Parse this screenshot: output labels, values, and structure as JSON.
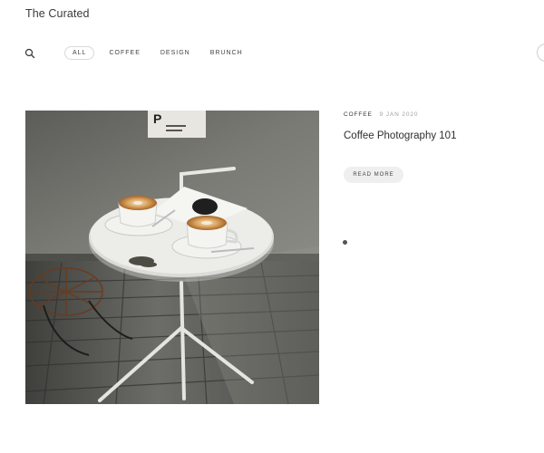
{
  "site": {
    "title": "The Curated"
  },
  "nav": {
    "search_icon": "search-icon",
    "items": [
      {
        "label": "ALL",
        "active": true
      },
      {
        "label": "COFFEE",
        "active": false
      },
      {
        "label": "DESIGN",
        "active": false
      },
      {
        "label": "BRUNCH",
        "active": false
      }
    ]
  },
  "post": {
    "image_description": "coffee-table-photo",
    "sign_letter": "P",
    "category": "COFFEE",
    "date": "9 JAN 2020",
    "title": "Coffee Photography 101",
    "read_more_label": "READ MORE"
  },
  "pagination": {
    "dot_count": 1
  },
  "colors": {
    "text": "#333333",
    "muted": "#a0a0a0",
    "button_bg": "#efefef"
  }
}
